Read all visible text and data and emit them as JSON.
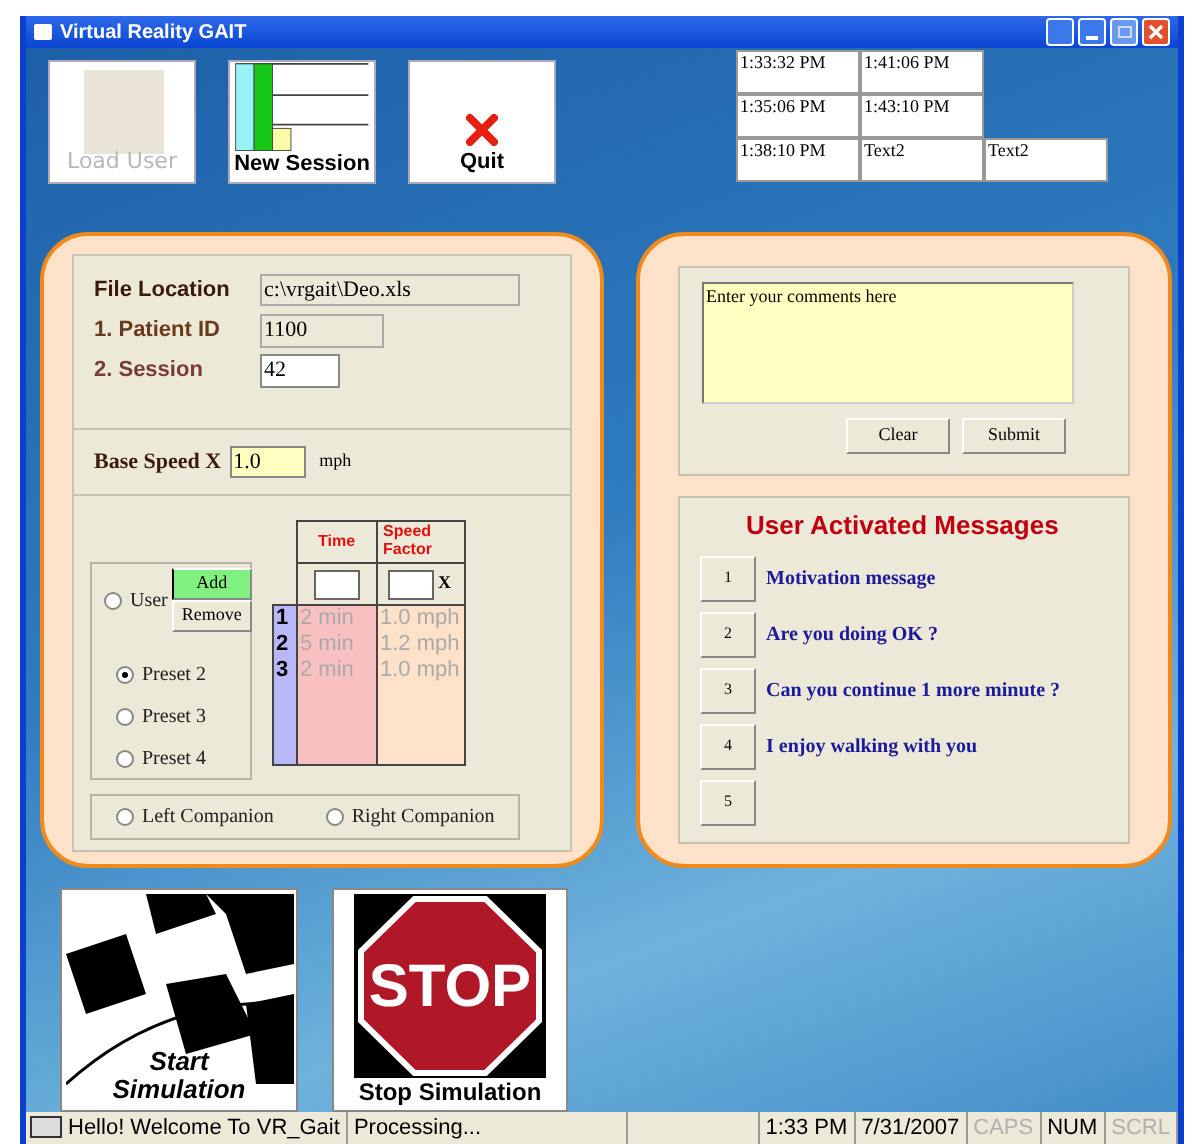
{
  "window": {
    "title": "Virtual Reality GAIT"
  },
  "toolbar": [
    {
      "kind": "load",
      "label": "Load User",
      "disabled": true
    },
    {
      "kind": "session",
      "label": "New Session",
      "disabled": false
    },
    {
      "kind": "quit",
      "label": "Quit",
      "disabled": false
    }
  ],
  "time_grid": [
    [
      "1:33:32 PM",
      "1:41:06 PM"
    ],
    [
      "1:35:06 PM",
      "1:43:10 PM"
    ],
    [
      "1:38:10 PM",
      "Text2",
      "Text2"
    ]
  ],
  "patient": {
    "file_location_label": "File Location",
    "file_location": "c:\\vrgait\\Deo.xls",
    "patient_id_label": "1. Patient ID",
    "patient_id": "1100",
    "session_label": "2. Session",
    "session": "42"
  },
  "base_speed": {
    "label": "Base Speed X",
    "value": "1.0",
    "unit": "mph"
  },
  "program": {
    "user": {
      "label": "User",
      "selected": false
    },
    "add_button": "Add",
    "remove_button": "Remove",
    "presets": [
      {
        "label": "Preset 2",
        "selected": true
      },
      {
        "label": "Preset 3",
        "selected": false
      },
      {
        "label": "Preset 4",
        "selected": false
      }
    ],
    "columns": [
      "Time",
      "Speed Factor"
    ],
    "factor_mark": "X",
    "rows": [
      {
        "index": "1",
        "time": "2 min",
        "speed": "1.0 mph"
      },
      {
        "index": "2",
        "time": "5 min",
        "speed": "1.2 mph"
      },
      {
        "index": "3",
        "time": "2 min",
        "speed": "1.0 mph"
      }
    ],
    "rows_disabled": true,
    "companions": [
      {
        "label": "Left Companion",
        "selected": false
      },
      {
        "label": "Right Companion",
        "selected": false
      }
    ]
  },
  "comments": {
    "value": "Enter your comments here",
    "buttons": [
      "Clear",
      "Submit"
    ]
  },
  "messages": {
    "title": "User Activated Messages",
    "items": [
      {
        "key": "1",
        "text": "Motivation message"
      },
      {
        "key": "2",
        "text": "Are you doing OK ?"
      },
      {
        "key": "3",
        "text": "Can you continue 1 more minute ?"
      },
      {
        "key": "4",
        "text": "I enjoy walking with you"
      },
      {
        "key": "5"
      }
    ]
  },
  "simulation": {
    "start_label": "Start Simulation",
    "stop_label": "Stop Simulation",
    "sign_text": "STOP"
  },
  "status_bar": {
    "message": "Hello! Welcome To VR_Gait",
    "status": "Processing...",
    "time": "1:33 PM",
    "date": "7/31/2007",
    "keys": [
      {
        "label": "CAPS",
        "on": false
      },
      {
        "label": "NUM",
        "on": true
      },
      {
        "label": "SCRL",
        "on": false
      }
    ]
  }
}
